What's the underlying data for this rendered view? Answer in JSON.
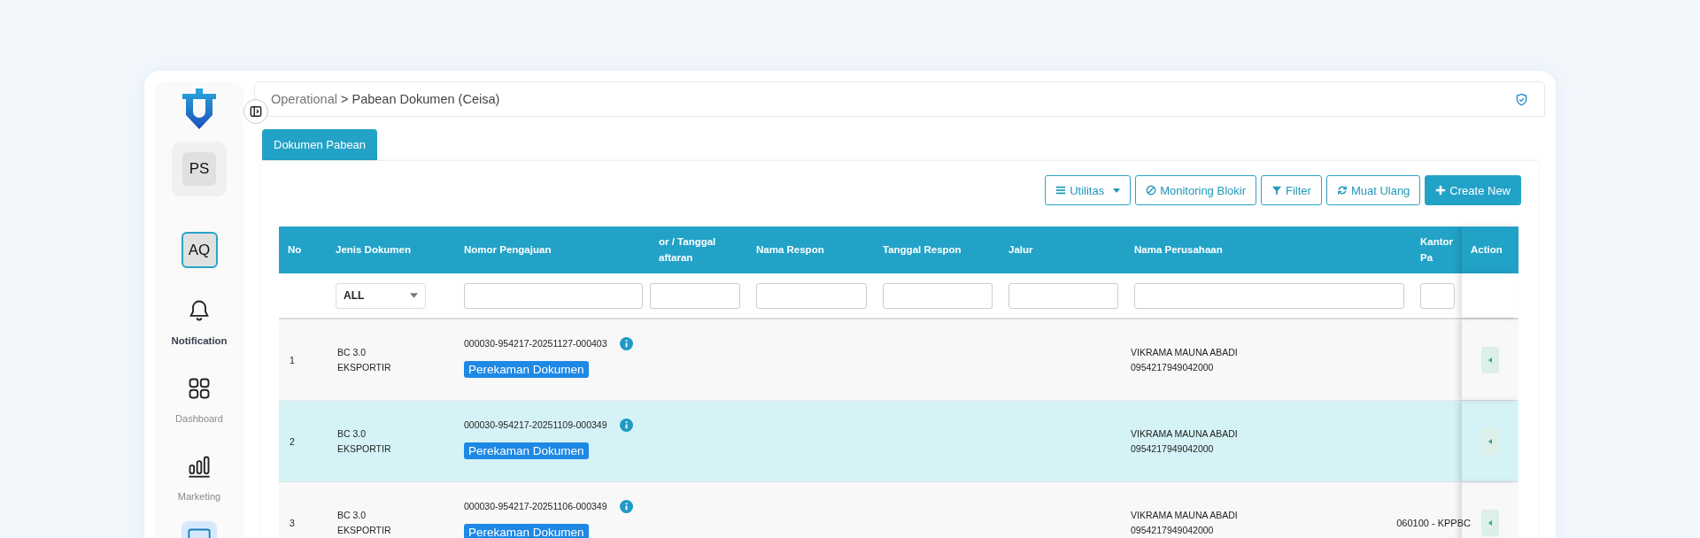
{
  "sidebar": {
    "workspace_badge": "PS",
    "account_badge": "AQ",
    "items": [
      {
        "kind": "bell",
        "label": "Notification",
        "highlighted": true,
        "selected": false
      },
      {
        "kind": "grid",
        "label": "Dashboard",
        "highlighted": false,
        "selected": false
      },
      {
        "kind": "chart",
        "label": "Marketing",
        "highlighted": false,
        "selected": false
      },
      {
        "kind": "monitor",
        "selected": true
      }
    ]
  },
  "breadcrumb": {
    "parent": "Operational",
    "separator": ">",
    "current": "Pabean Dokumen (Ceisa)"
  },
  "tabs": [
    {
      "label": "Dokumen Pabean",
      "selected": true
    }
  ],
  "toolbar": [
    {
      "kind": "menu",
      "label": "Utilitas",
      "primary": false
    },
    {
      "kind": "block",
      "label": "Monitoring Blokir",
      "primary": false
    },
    {
      "kind": "filter",
      "label": "Filter",
      "primary": false
    },
    {
      "kind": "refresh",
      "label": "Muat Ulang",
      "primary": false
    },
    {
      "kind": "plus",
      "label": "Create New",
      "primary": true
    }
  ],
  "table": {
    "columns": [
      {
        "label": "No",
        "kind": "none"
      },
      {
        "label": "Jenis Dokumen",
        "kind": "select",
        "value": "ALL"
      },
      {
        "label": "Nomor Pengajuan",
        "kind": "text"
      },
      {
        "label": "or / Tanggal aftaran",
        "kind": "text"
      },
      {
        "label": "Nama Respon",
        "kind": "text"
      },
      {
        "label": "Tanggal Respon",
        "kind": "text"
      },
      {
        "label": "Jalur",
        "kind": "text"
      },
      {
        "label": "Nama Perusahaan",
        "kind": "text"
      },
      {
        "label": "Kantor Pa",
        "kind": "text"
      },
      {
        "label": "Action",
        "kind": "none"
      }
    ],
    "rows": [
      {
        "no": "1",
        "doc_type": [
          "BC 3.0",
          "EKSPORTIR"
        ],
        "submission_no": "000030-954217-20251127-000403",
        "status": "Perekaman Dokumen",
        "company": [
          "VIKRAMA MAUNA ABADI",
          "0954217949042000"
        ],
        "selected": false
      },
      {
        "no": "2",
        "doc_type": [
          "BC 3.0",
          "EKSPORTIR"
        ],
        "submission_no": "000030-954217-20251109-000349",
        "status": "Perekaman Dokumen",
        "company": [
          "VIKRAMA MAUNA ABADI",
          "0954217949042000"
        ],
        "selected": true
      },
      {
        "no": "3",
        "doc_type": [
          "BC 3.0",
          "EKSPORTIR"
        ],
        "submission_no": "000030-954217-20251106-000349",
        "status": "Perekaman Dokumen",
        "company": [
          "VIKRAMA MAUNA ABADI",
          "0954217949042000"
        ],
        "office": "060100 - KPPBC",
        "selected": false
      }
    ]
  }
}
